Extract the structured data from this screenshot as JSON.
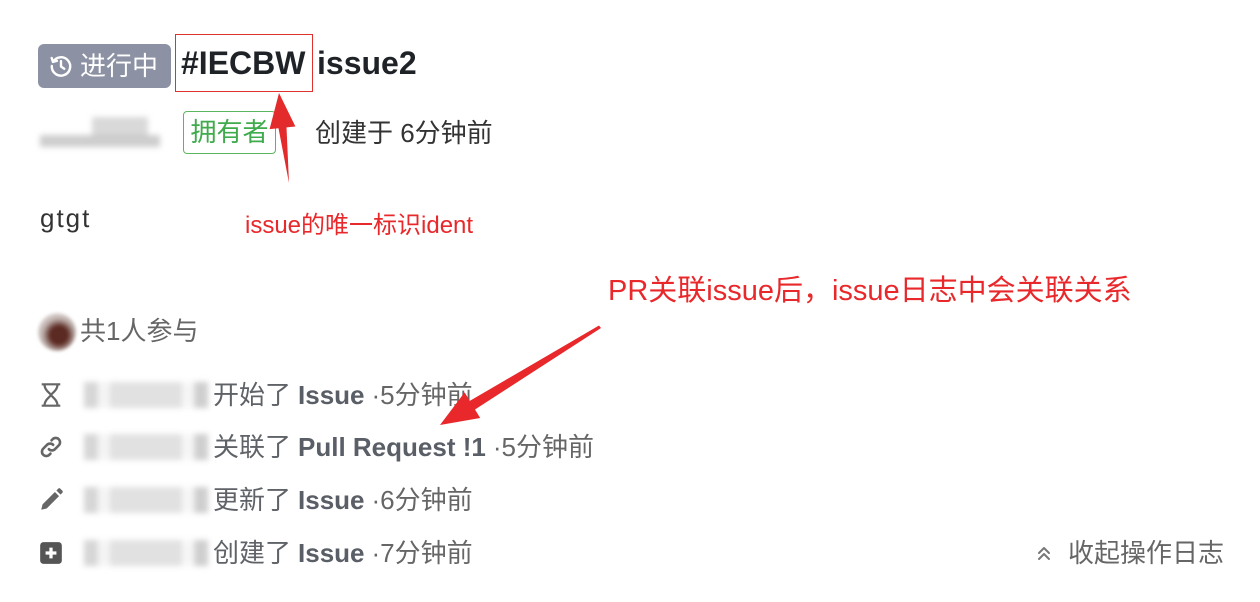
{
  "issue": {
    "status": {
      "label": "进行中",
      "icon": "in-progress-icon"
    },
    "ident": "#IECBW",
    "title": "issue2",
    "author_role": "拥有者",
    "created": "创建于 6分钟前",
    "description": "gtgt"
  },
  "participants": {
    "label": "共1人参与"
  },
  "activity_log": [
    {
      "icon": "hourglass-icon",
      "action": "开始了",
      "target": "Issue",
      "time": "·5分钟前"
    },
    {
      "icon": "link-icon",
      "action": "关联了",
      "target": "Pull Request !1",
      "time": "·5分钟前"
    },
    {
      "icon": "pencil-icon",
      "action": "更新了",
      "target": "Issue",
      "time": "·6分钟前"
    },
    {
      "icon": "plus-square-icon",
      "action": "创建了",
      "target": "Issue",
      "time": "·7分钟前"
    }
  ],
  "collapse_log": {
    "label": "收起操作日志",
    "icon": "double-chevron-up-icon"
  },
  "annotations": {
    "ident_note": "issue的唯一标识ident",
    "pr_link_note": "PR关联issue后，issue日志中会关联关系"
  },
  "colors": {
    "status_badge": "#8c92a4",
    "owner_tag": "#3fab4c",
    "annotation_red": "#e8282b",
    "text_primary": "#1f2328",
    "text_secondary": "#666666"
  }
}
